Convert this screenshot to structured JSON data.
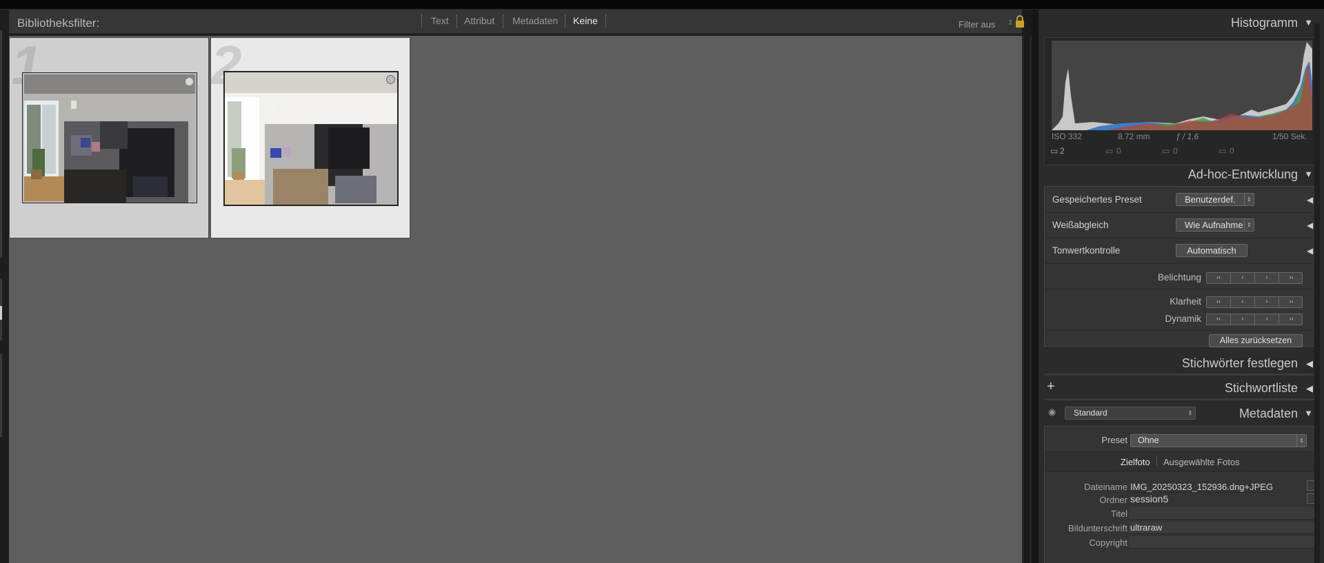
{
  "filter_bar": {
    "label": "Bibliotheksfilter:",
    "tabs": [
      "Text",
      "Attribut",
      "Metadaten",
      "Keine"
    ],
    "active_tab": "Keine",
    "filter_status": "Filter aus"
  },
  "grid": {
    "cells": [
      {
        "number": "1",
        "selected": true
      },
      {
        "number": "2",
        "selected": false
      }
    ]
  },
  "histogram": {
    "title": "Histogramm",
    "iso": "ISO 332",
    "focal": "8.72 mm",
    "aperture": "ƒ / 1,6",
    "shutter": "1/50 Sek.",
    "counts": [
      "2",
      "0",
      "0",
      "0"
    ]
  },
  "quick_develop": {
    "title": "Ad-hoc-Entwicklung",
    "saved_preset_label": "Gespeichertes Preset",
    "saved_preset_value": "Benutzerdef.",
    "white_balance_label": "Weißabgleich",
    "white_balance_value": "Wie Aufnahme",
    "tone_control_label": "Tonwertkontrolle",
    "auto_button": "Automatisch",
    "exposure_label": "Belichtung",
    "clarity_label": "Klarheit",
    "vibrance_label": "Dynamik",
    "reset_button": "Alles zurücksetzen"
  },
  "keywording": {
    "title": "Stichwörter festlegen"
  },
  "keyword_list": {
    "title": "Stichwortliste",
    "add": "+"
  },
  "metadata": {
    "title": "Metadaten",
    "view_value": "Standard",
    "preset_label": "Preset",
    "preset_value": "Ohne",
    "tab_target": "Zielfoto",
    "tab_selected": "Ausgewählte Fotos",
    "fields": [
      {
        "label": "Dateiname",
        "value": "IMG_20250323_152936.dng+JPEG"
      },
      {
        "label": "Ordner",
        "value": "session5"
      },
      {
        "label": "Titel",
        "value": ""
      },
      {
        "label": "Bildunterschrift",
        "value": "ultraraw"
      },
      {
        "label": "Copyright",
        "value": ""
      }
    ]
  },
  "colors": {
    "grid_bg": "#5e5e5e",
    "panel_bg": "#2b2b2b",
    "selected_cell": "#cfcfcf",
    "unselected_cell": "#e9e9e9",
    "lock": "#c9a227"
  }
}
